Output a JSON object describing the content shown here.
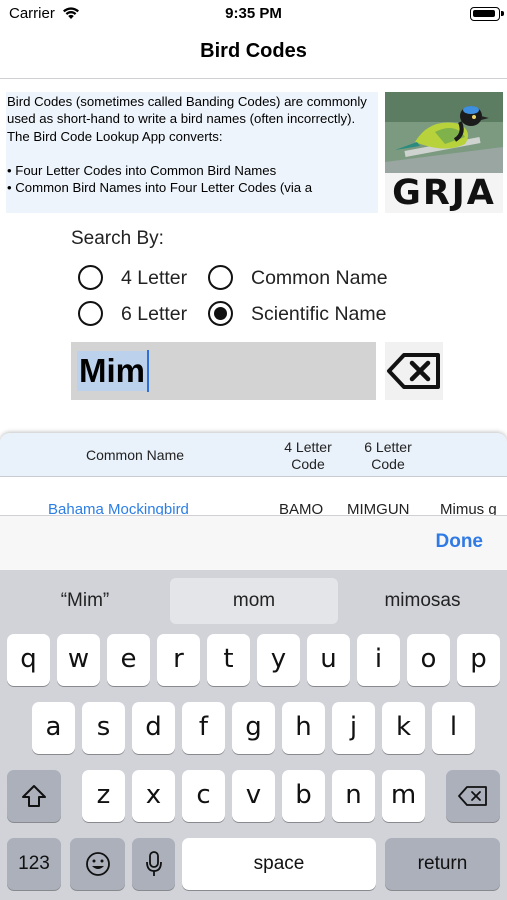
{
  "status": {
    "carrier": "Carrier",
    "time": "9:35 PM"
  },
  "nav": {
    "title": "Bird Codes"
  },
  "intro": {
    "text": "Bird Codes (sometimes called Banding Codes) are commonly used as short-hand to write a bird names (often incorrectly). The Bird Code Lookup App converts:\n\n• Four Letter Codes into Common Bird Names\n• Common Bird Names into Four Letter Codes (via a",
    "image_code": "GRJA"
  },
  "search": {
    "label": "Search By:",
    "options": [
      {
        "label": "4 Letter",
        "selected": false
      },
      {
        "label": "Common Name",
        "selected": false
      },
      {
        "label": "6 Letter",
        "selected": false
      },
      {
        "label": "Scientific Name",
        "selected": true
      }
    ],
    "value": "Mim"
  },
  "results": {
    "headers": {
      "common": "Common Name",
      "four": "4 Letter\nCode",
      "six": "6 Letter\nCode"
    },
    "rows": [
      {
        "common": "Bahama Mockingbird",
        "four": "BAMO",
        "six": "MIMGUN",
        "scientific": "Mimus g"
      }
    ]
  },
  "keyboard": {
    "done": "Done",
    "suggestions": [
      "“Mim”",
      "mom",
      "mimosas"
    ],
    "row1": [
      "q",
      "w",
      "e",
      "r",
      "t",
      "y",
      "u",
      "i",
      "o",
      "p"
    ],
    "row2": [
      "a",
      "s",
      "d",
      "f",
      "g",
      "h",
      "j",
      "k",
      "l"
    ],
    "row3": [
      "z",
      "x",
      "c",
      "v",
      "b",
      "n",
      "m"
    ],
    "numbers": "123",
    "space": "space",
    "return": "return"
  }
}
